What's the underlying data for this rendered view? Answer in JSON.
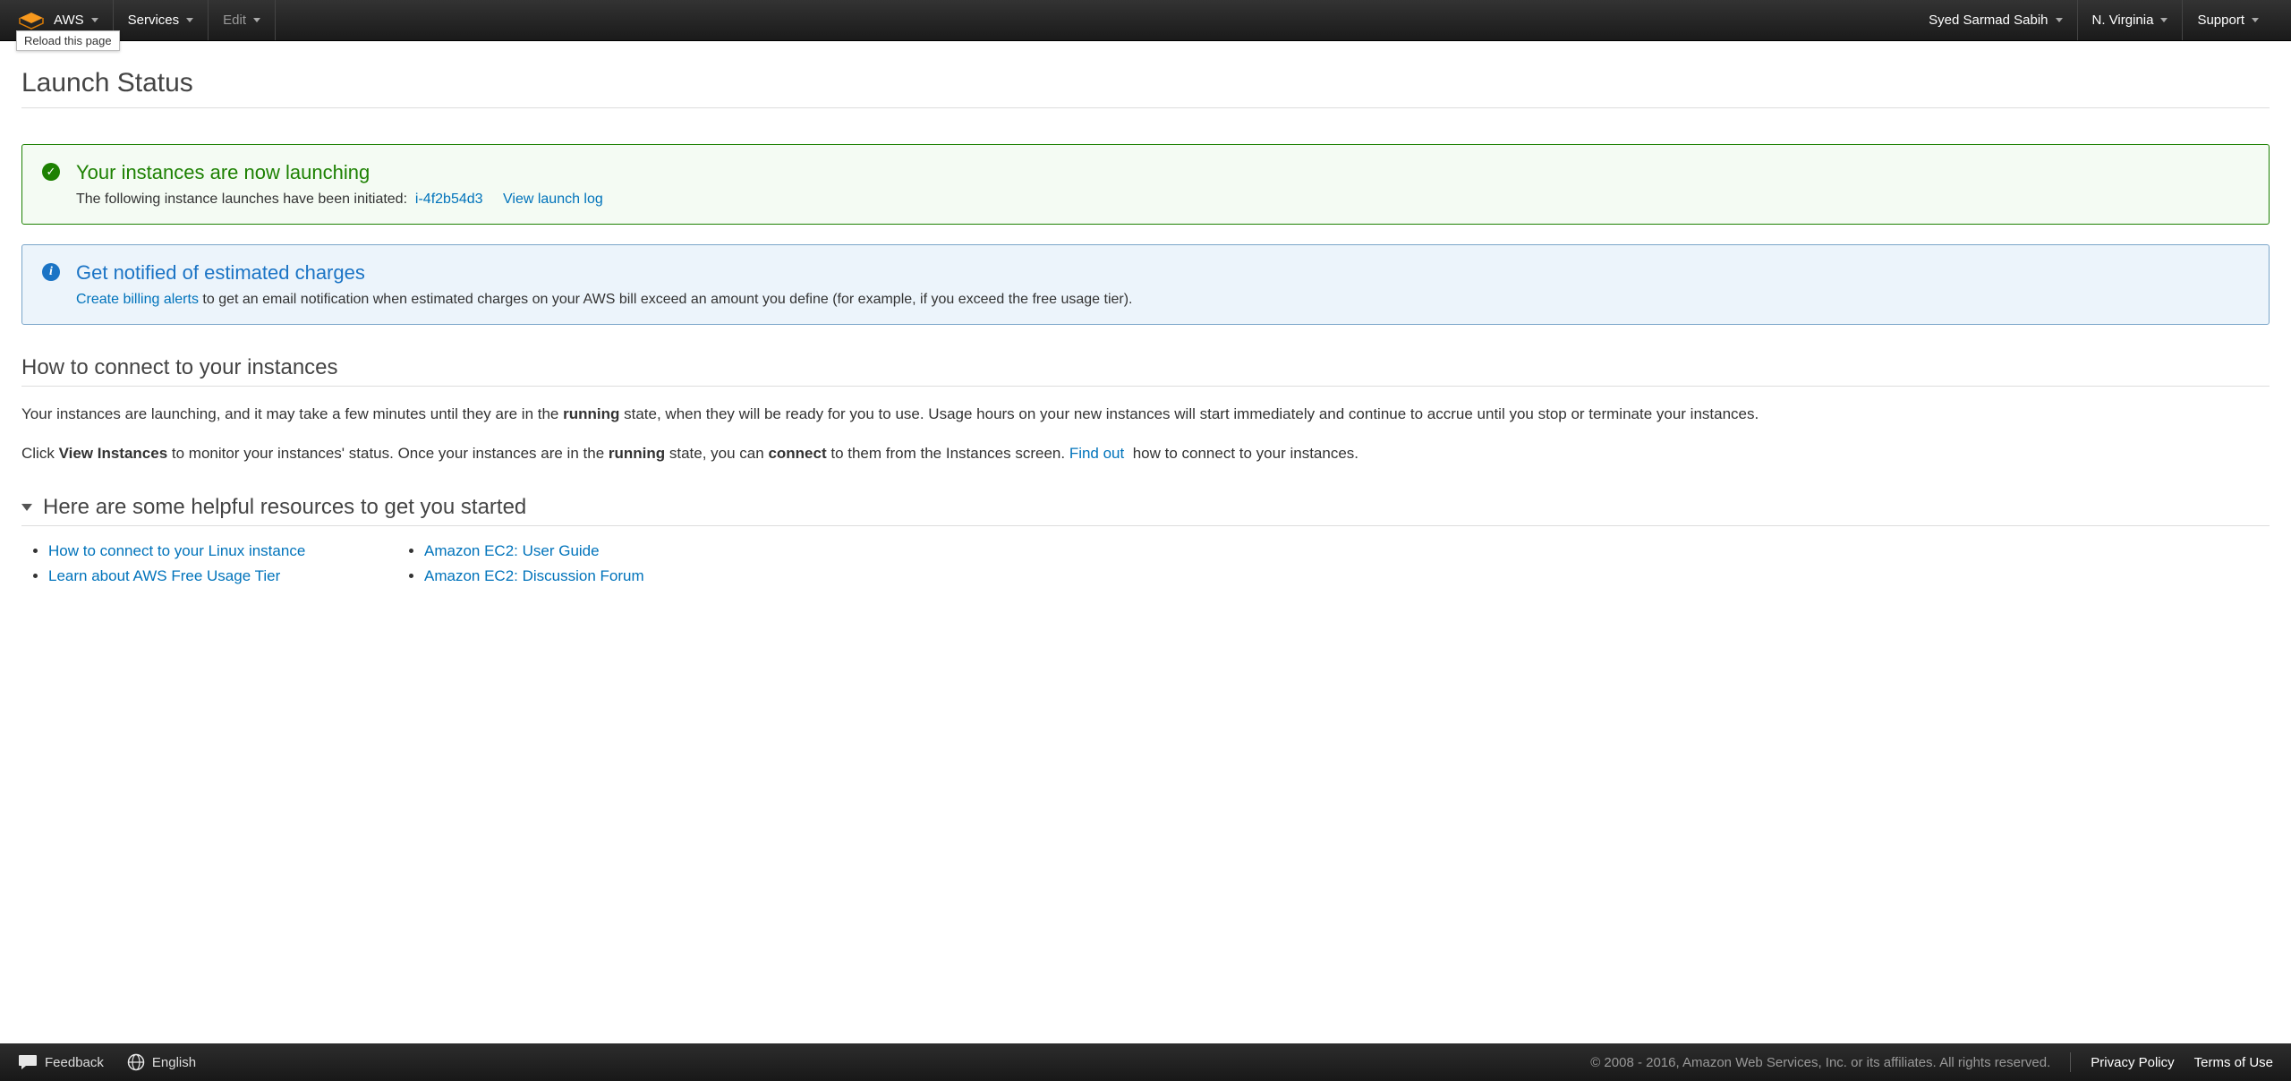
{
  "nav": {
    "brand": "AWS",
    "services": "Services",
    "edit": "Edit",
    "user": "Syed Sarmad Sabih",
    "region": "N. Virginia",
    "support": "Support",
    "tooltip": "Reload this page"
  },
  "page": {
    "title": "Launch Status"
  },
  "success": {
    "title": "Your instances are now launching",
    "lead": "The following instance launches have been initiated:",
    "instance_id": "i-4f2b54d3",
    "view_log": "View launch log"
  },
  "notify": {
    "title": "Get notified of estimated charges",
    "link": "Create billing alerts",
    "rest": " to get an email notification when estimated charges on your AWS bill exceed an amount you define (for example, if you exceed the free usage tier)."
  },
  "connect": {
    "heading": "How to connect to your instances",
    "p1_a": "Your instances are launching, and it may take a few minutes until they are in the ",
    "p1_b": "running",
    "p1_c": " state, when they will be ready for you to use. Usage hours on your new instances will start immediately and continue to accrue until you stop or terminate your instances.",
    "p2_a": "Click ",
    "p2_b": "View Instances",
    "p2_c": " to monitor your instances' status. Once your instances are in the ",
    "p2_d": "running",
    "p2_e": " state, you can ",
    "p2_f": "connect",
    "p2_g": " to them from the Instances screen. ",
    "p2_link": "Find out",
    "p2_h": " how to connect to your instances."
  },
  "resources": {
    "heading": "Here are some helpful resources to get you started",
    "col1": [
      "How to connect to your Linux instance",
      "Learn about AWS Free Usage Tier"
    ],
    "col2": [
      "Amazon EC2: User Guide",
      "Amazon EC2: Discussion Forum"
    ]
  },
  "footer": {
    "feedback": "Feedback",
    "language": "English",
    "copyright": "© 2008 - 2016, Amazon Web Services, Inc. or its affiliates. All rights reserved.",
    "privacy": "Privacy Policy",
    "terms": "Terms of Use"
  }
}
